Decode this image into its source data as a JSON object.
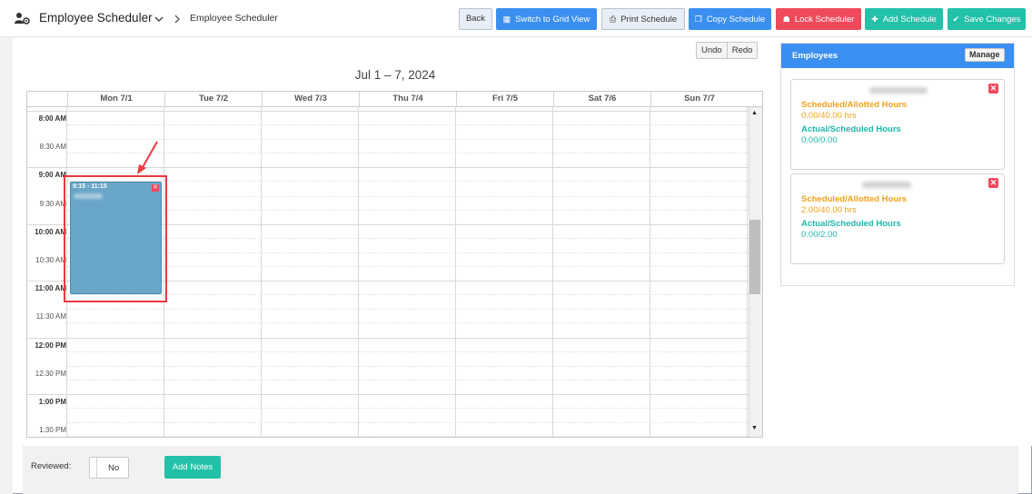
{
  "header": {
    "app_title": "Employee Scheduler",
    "breadcrumb": "Employee Scheduler",
    "buttons": {
      "back": "Back",
      "grid_view": "Switch to Grid View",
      "print": "Print Schedule",
      "copy": "Copy Schedule",
      "lock": "Lock Scheduler",
      "add": "Add Schedule",
      "save": "Save Changes"
    }
  },
  "toolbar": {
    "undo": "Undo",
    "redo": "Redo"
  },
  "calendar": {
    "title": "Jul 1 – 7, 2024",
    "days": [
      "Mon 7/1",
      "Tue 7/2",
      "Wed 7/3",
      "Thu 7/4",
      "Fri 7/5",
      "Sat 7/6",
      "Sun 7/7"
    ],
    "times": [
      "8:00 AM",
      "8:30 AM",
      "9:00 AM",
      "9:30 AM",
      "10:00 AM",
      "10:30 AM",
      "11:00 AM",
      "11:30 AM",
      "12:00 PM",
      "12:30 PM",
      "1:00 PM",
      "1:30 PM"
    ],
    "event": {
      "time": "9:15 - 11:15",
      "day": "Mon 7/1"
    }
  },
  "employees": {
    "title": "Employees",
    "manage_label": "Manage",
    "cards": [
      {
        "scheduled_allotted_label": "Scheduled/Allotted Hours",
        "scheduled_allotted_value": "0.00/40.00 hrs",
        "actual_scheduled_label": "Actual/Scheduled Hours",
        "actual_scheduled_value": "0.00/0.00"
      },
      {
        "scheduled_allotted_label": "Scheduled/Allotted Hours",
        "scheduled_allotted_value": "2.00/40.00 hrs",
        "actual_scheduled_label": "Actual/Scheduled Hours",
        "actual_scheduled_value": "0.00/2.00"
      }
    ]
  },
  "footer": {
    "reviewed_label": "Reviewed:",
    "reviewed_value": "No",
    "add_notes": "Add Notes"
  },
  "colors": {
    "primary_blue": "#3a8ff0",
    "danger_red": "#ef4a5b",
    "teal": "#22c1a8",
    "orange": "#f0a21d",
    "event_blue": "#6aa6c8"
  }
}
